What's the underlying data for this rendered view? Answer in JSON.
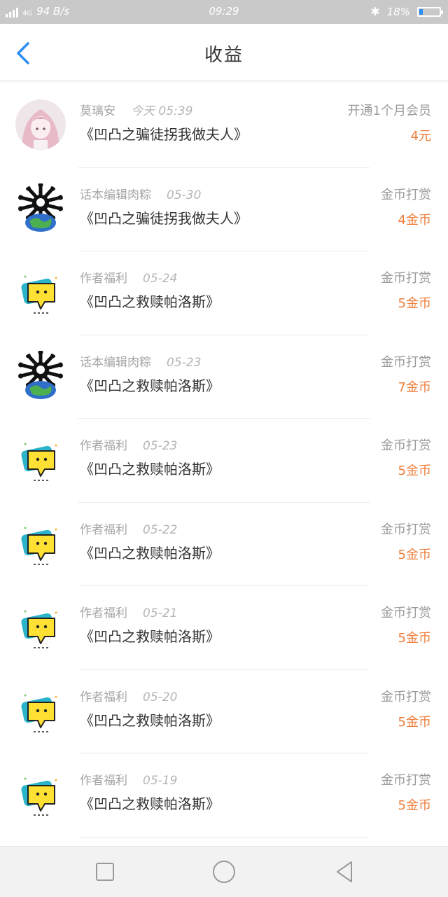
{
  "status": {
    "network": "4G",
    "speed": "94 B/s",
    "time": "09:29",
    "battery": "18%"
  },
  "header": {
    "title": "收益"
  },
  "colors": {
    "accent": "#2b8ef0",
    "amount": "#ef7d3a"
  },
  "records": [
    {
      "avatar": "anime-girl-avatar",
      "name": "莫璃安",
      "date": "今天 05:39",
      "book": "《凹凸之骗徒拐我做夫人》",
      "type": "开通1个月会员",
      "amount": "4元"
    },
    {
      "avatar": "spiky-earth-avatar",
      "name": "话本编辑肉粽",
      "date": "05-30",
      "book": "《凹凸之骗徒拐我做夫人》",
      "type": "金币打赏",
      "amount": "4金币"
    },
    {
      "avatar": "yellow-chat-bubble-avatar",
      "name": "作者福利",
      "date": "05-24",
      "book": "《凹凸之救赎帕洛斯》",
      "type": "金币打赏",
      "amount": "5金币"
    },
    {
      "avatar": "spiky-earth-avatar",
      "name": "话本编辑肉粽",
      "date": "05-23",
      "book": "《凹凸之救赎帕洛斯》",
      "type": "金币打赏",
      "amount": "7金币"
    },
    {
      "avatar": "yellow-chat-bubble-avatar",
      "name": "作者福利",
      "date": "05-23",
      "book": "《凹凸之救赎帕洛斯》",
      "type": "金币打赏",
      "amount": "5金币"
    },
    {
      "avatar": "yellow-chat-bubble-avatar",
      "name": "作者福利",
      "date": "05-22",
      "book": "《凹凸之救赎帕洛斯》",
      "type": "金币打赏",
      "amount": "5金币"
    },
    {
      "avatar": "yellow-chat-bubble-avatar",
      "name": "作者福利",
      "date": "05-21",
      "book": "《凹凸之救赎帕洛斯》",
      "type": "金币打赏",
      "amount": "5金币"
    },
    {
      "avatar": "yellow-chat-bubble-avatar",
      "name": "作者福利",
      "date": "05-20",
      "book": "《凹凸之救赎帕洛斯》",
      "type": "金币打赏",
      "amount": "5金币"
    },
    {
      "avatar": "yellow-chat-bubble-avatar",
      "name": "作者福利",
      "date": "05-19",
      "book": "《凹凸之救赎帕洛斯》",
      "type": "金币打赏",
      "amount": "5金币"
    }
  ],
  "nav": {
    "buttons": [
      "recent-apps-icon",
      "home-icon",
      "back-triangle-icon"
    ]
  }
}
